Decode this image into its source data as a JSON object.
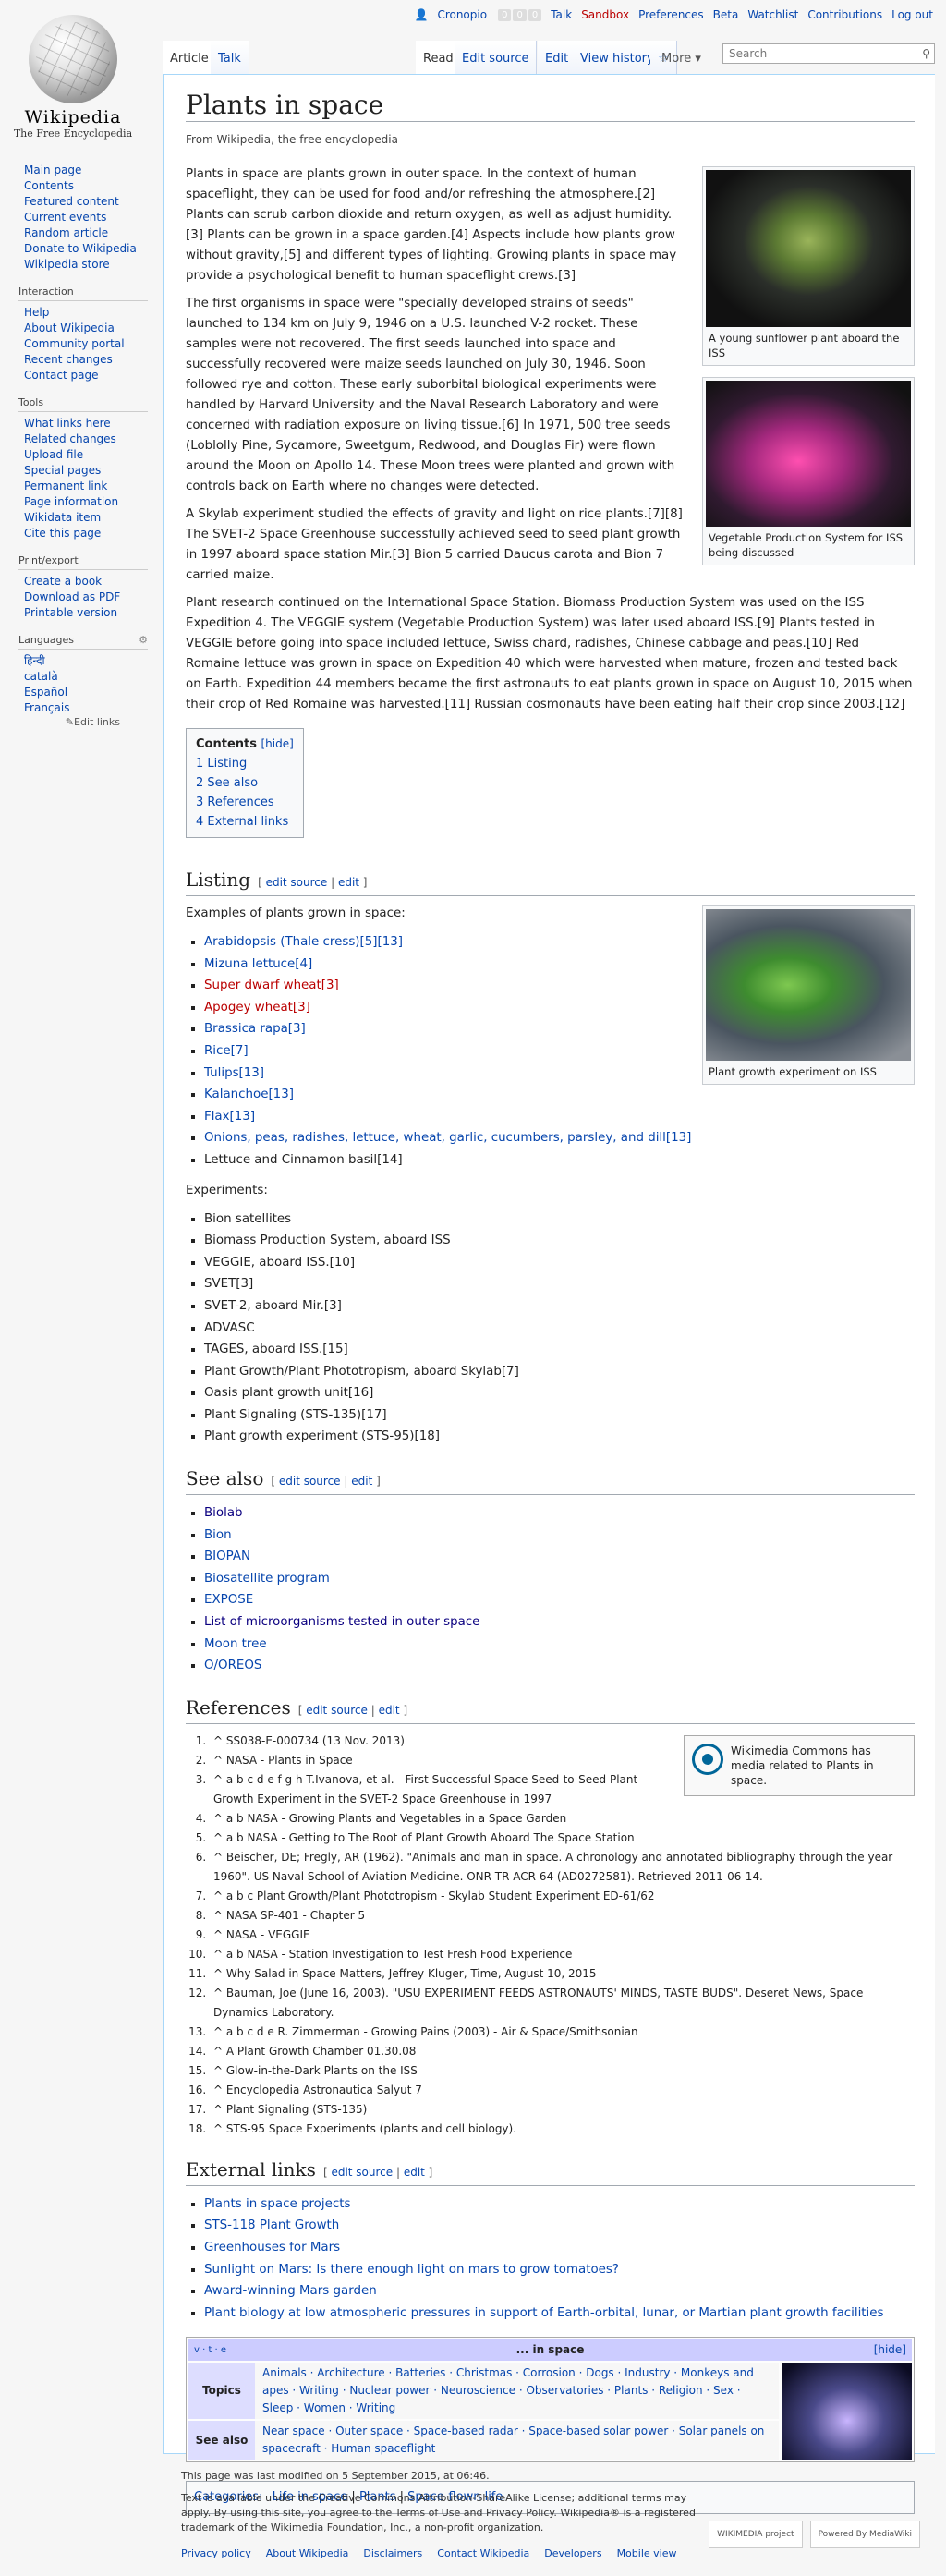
{
  "personal": {
    "user": "Cronopio",
    "talk": "Talk",
    "sandbox": "Sandbox",
    "preferences": "Preferences",
    "beta": "Beta",
    "watchlist": "Watchlist",
    "contributions": "Contributions",
    "logout": "Log out"
  },
  "logo": {
    "wordmark": "Wikipedia",
    "tagline": "The Free Encyclopedia"
  },
  "sidebar": {
    "main": [
      "Main page",
      "Contents",
      "Featured content",
      "Current events",
      "Random article",
      "Donate to Wikipedia",
      "Wikipedia store"
    ],
    "interaction_h": "Interaction",
    "interaction": [
      "Help",
      "About Wikipedia",
      "Community portal",
      "Recent changes",
      "Contact page"
    ],
    "tools_h": "Tools",
    "tools": [
      "What links here",
      "Related changes",
      "Upload file",
      "Special pages",
      "Permanent link",
      "Page information",
      "Wikidata item",
      "Cite this page"
    ],
    "print_h": "Print/export",
    "print": [
      "Create a book",
      "Download as PDF",
      "Printable version"
    ],
    "languages_h": "Languages",
    "languages": [
      "हिन्दी",
      "català",
      "Español",
      "Français"
    ],
    "edit_links": "Edit links"
  },
  "tabs": {
    "article": "Article",
    "talk": "Talk",
    "read": "Read",
    "edit_source": "Edit source",
    "edit": "Edit",
    "history": "View history",
    "star": "☆",
    "more": "More",
    "search_placeholder": "Search"
  },
  "article": {
    "title": "Plants in space",
    "sub": "From Wikipedia, the free encyclopedia",
    "fig1": "A young sunflower plant aboard the ISS",
    "fig2": "Vegetable Production System for ISS being discussed",
    "fig3": "Plant growth experiment on ISS",
    "p1": "Plants in space are plants grown in outer space. In the context of human spaceflight, they can be used for food and/or refreshing the atmosphere.[2] Plants can scrub carbon dioxide and return oxygen, as well as adjust humidity.[3] Plants can be grown in a space garden.[4] Aspects include how plants grow without gravity,[5] and different types of lighting. Growing plants in space may provide a psychological benefit to human spaceflight crews.[3]",
    "p2": "The first organisms in space were \"specially developed strains of seeds\" launched to 134 km on July 9, 1946 on a U.S. launched V-2 rocket. These samples were not recovered. The first seeds launched into space and successfully recovered were maize seeds launched on July 30, 1946. Soon followed rye and cotton. These early suborbital biological experiments were handled by Harvard University and the Naval Research Laboratory and were concerned with radiation exposure on living tissue.[6] In 1971, 500 tree seeds (Loblolly Pine, Sycamore, Sweetgum, Redwood, and Douglas Fir) were flown around the Moon on Apollo 14. These Moon trees were planted and grown with controls back on Earth where no changes were detected.",
    "p3": "A Skylab experiment studied the effects of gravity and light on rice plants.[7][8] The SVET-2 Space Greenhouse successfully achieved seed to seed plant growth in 1997 aboard space station Mir.[3] Bion 5 carried Daucus carota and Bion 7 carried maize.",
    "p4": "Plant research continued on the International Space Station. Biomass Production System was used on the ISS Expedition 4. The VEGGIE system (Vegetable Production System) was later used aboard ISS.[9] Plants tested in VEGGIE before going into space included lettuce, Swiss chard, radishes, Chinese cabbage and peas.[10] Red Romaine lettuce was grown in space on Expedition 40 which were harvested when mature, frozen and tested back on Earth. Expedition 44 members became the first astronauts to eat plants grown in space on August 10, 2015 when their crop of Red Romaine was harvested.[11] Russian cosmonauts have been eating half their crop since 2003.[12]"
  },
  "toc": {
    "title": "Contents",
    "hide": "[hide]",
    "items": [
      "1 Listing",
      "2 See also",
      "3 References",
      "4 External links"
    ]
  },
  "listing": {
    "heading": "Listing",
    "edit_source": "edit source",
    "edit": "edit",
    "intro": "Examples of plants grown in space:",
    "plants": [
      "Arabidopsis (Thale cress)[5][13]",
      "Mizuna lettuce[4]",
      "Super dwarf wheat[3]",
      "Apogey wheat[3]",
      "Brassica rapa[3]",
      "Rice[7]",
      "Tulips[13]",
      "Kalanchoe[13]",
      "Flax[13]",
      "Onions, peas, radishes, lettuce, wheat, garlic, cucumbers, parsley, and dill[13]",
      "Lettuce and Cinnamon basil[14]"
    ],
    "experiments_label": "Experiments:",
    "experiments": [
      "Bion satellites",
      "Biomass Production System, aboard ISS",
      "VEGGIE, aboard ISS.[10]",
      "SVET[3]",
      "SVET-2, aboard Mir.[3]",
      "ADVASC",
      "TAGES, aboard ISS.[15]",
      "Plant Growth/Plant Phototropism, aboard Skylab[7]",
      "Oasis plant growth unit[16]",
      "Plant Signaling (STS-135)[17]",
      "Plant growth experiment (STS-95)[18]"
    ]
  },
  "seealso": {
    "heading": "See also",
    "items": [
      "Biolab",
      "Bion",
      "BIOPAN",
      "Biosatellite program",
      "EXPOSE",
      "List of microorganisms tested in outer space",
      "Moon tree",
      "O/OREOS"
    ]
  },
  "references": {
    "heading": "References",
    "commons": "Wikimedia Commons has media related to Plants in space.",
    "items": [
      "^ SS038-E-000734 (13 Nov. 2013)",
      "^ NASA - Plants in Space",
      "^ a b c d e f g h T.Ivanova, et al. - First Successful Space Seed-to-Seed Plant Growth Experiment in the SVET-2 Space Greenhouse in 1997",
      "^ a b NASA - Growing Plants and Vegetables in a Space Garden",
      "^ a b NASA - Getting to The Root of Plant Growth Aboard The Space Station",
      "^ Beischer, DE; Fregly, AR (1962). \"Animals and man in space. A chronology and annotated bibliography through the year 1960\". US Naval School of Aviation Medicine. ONR TR ACR-64 (AD0272581). Retrieved 2011-06-14.",
      "^ a b c Plant Growth/Plant Phototropism - Skylab Student Experiment ED-61/62",
      "^ NASA SP-401 - Chapter 5",
      "^ NASA - VEGGIE",
      "^ a b NASA - Station Investigation to Test Fresh Food Experience",
      "^ Why Salad in Space Matters, Jeffrey Kluger, Time, August 10, 2015",
      "^ Bauman, Joe (June 16, 2003). \"USU EXPERIMENT FEEDS ASTRONAUTS' MINDS, TASTE BUDS\". Deseret News, Space Dynamics Laboratory.",
      "^ a b c d e R. Zimmerman - Growing Pains (2003) - Air & Space/Smithsonian",
      "^ A Plant Growth Chamber 01.30.08",
      "^ Glow-in-the-Dark Plants on the ISS",
      "^ Encyclopedia Astronautica Salyut 7",
      "^ Plant Signaling (STS-135)",
      "^ STS-95 Space Experiments (plants and cell biology)."
    ]
  },
  "external": {
    "heading": "External links",
    "items": [
      "Plants in space projects",
      "STS-118 Plant Growth",
      "Greenhouses for Mars",
      "Sunlight on Mars: Is there enough light on mars to grow tomatoes?",
      "Award-winning Mars garden",
      "Plant biology at low atmospheric pressures in support of Earth-orbital, lunar, or Martian plant growth facilities"
    ]
  },
  "navbox": {
    "vte": "v · t · e",
    "title": "... in space",
    "hide": "[hide]",
    "topics_h": "Topics",
    "topics": "Animals · Architecture · Batteries · Christmas · Corrosion · Dogs · Industry · Monkeys and apes · Writing · Nuclear power · Neuroscience · Observatories · Plants · Religion · Sex · Sleep · Women · Writing",
    "see_h": "See also",
    "see": "Near space · Outer space · Space-based radar · Space-based solar power · Solar panels on spacecraft · Human spaceflight"
  },
  "categories": {
    "label": "Categories:",
    "items": [
      "Life in space",
      "Plants",
      "Space-flown life"
    ]
  },
  "footer": {
    "modified": "This page was last modified on 5 September 2015, at 06:46.",
    "license": "Text is available under the Creative Commons Attribution-ShareAlike License; additional terms may apply. By using this site, you agree to the Terms of Use and Privacy Policy. Wikipedia® is a registered trademark of the Wikimedia Foundation, Inc., a non-profit organization.",
    "links": [
      "Privacy policy",
      "About Wikipedia",
      "Disclaimers",
      "Contact Wikipedia",
      "Developers",
      "Mobile view"
    ],
    "badge1": "WIKIMEDIA project",
    "badge2": "Powered By MediaWiki"
  }
}
